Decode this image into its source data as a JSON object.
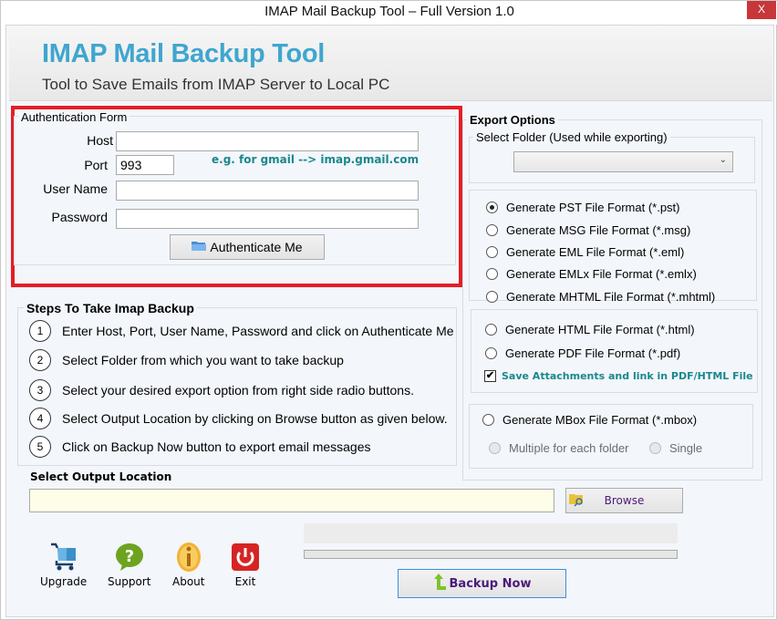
{
  "window": {
    "title": "IMAP Mail Backup Tool – Full Version 1.0",
    "close_label": "X"
  },
  "banner": {
    "title": "IMAP Mail Backup Tool",
    "subtitle": "Tool to Save Emails from IMAP Server to Local PC"
  },
  "auth": {
    "legend": "Authentication Form",
    "host_label": "Host",
    "host_value": "",
    "port_label": "Port",
    "port_value": "993",
    "hint": "e.g. for gmail -->  imap.gmail.com",
    "username_label": "User Name",
    "username_value": "",
    "password_label": "Password",
    "password_value": "",
    "authenticate_label": "Authenticate Me"
  },
  "steps": {
    "legend": "Steps To Take Imap Backup",
    "items": [
      {
        "num": "1",
        "text": "Enter Host, Port, User Name, Password and click on Authenticate Me"
      },
      {
        "num": "2",
        "text": "Select Folder from which you want to take backup"
      },
      {
        "num": "3",
        "text": "Select your desired export option from right side radio buttons."
      },
      {
        "num": "4",
        "text": "Select Output Location by clicking on Browse button as given below."
      },
      {
        "num": "5",
        "text": "Click on Backup Now button to export email messages"
      }
    ]
  },
  "export": {
    "legend": "Export Options",
    "folder_legend": "Select Folder (Used while exporting)",
    "folder_value": "",
    "formats": [
      {
        "label": "Generate PST File Format (*.pst)",
        "checked": true
      },
      {
        "label": "Generate MSG File Format (*.msg)",
        "checked": false
      },
      {
        "label": "Generate EML File Format (*.eml)",
        "checked": false
      },
      {
        "label": "Generate EMLx File Format  (*.emlx)",
        "checked": false
      },
      {
        "label": "Generate MHTML File Format (*.mhtml)",
        "checked": false
      }
    ],
    "doc_formats": [
      {
        "label": "Generate HTML File Format (*.html)",
        "checked": false
      },
      {
        "label": "Generate PDF File Format (*.pdf)",
        "checked": false
      }
    ],
    "save_attachments_label": "Save Attachments and link in PDF/HTML File",
    "save_attachments_checked": true,
    "mbox_label": "Generate MBox File Format (*.mbox)",
    "mbox_multiple_label": "Multiple for each folder",
    "mbox_single_label": "Single"
  },
  "output": {
    "label": "Select  Output Location",
    "value": "",
    "browse_label": "Browse"
  },
  "progress": {
    "status_text": "",
    "percent": 0
  },
  "tools": [
    {
      "name": "upgrade",
      "label": "Upgrade"
    },
    {
      "name": "support",
      "label": "Support"
    },
    {
      "name": "about",
      "label": "About"
    },
    {
      "name": "exit",
      "label": "Exit"
    }
  ],
  "backup_label": "Backup Now"
}
